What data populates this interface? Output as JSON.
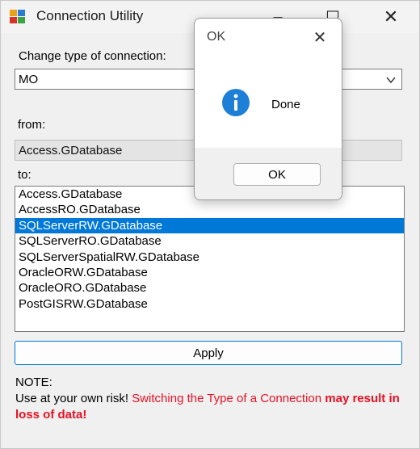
{
  "window": {
    "title": "Connection Utility",
    "minimize_glyph": "–",
    "maximize_glyph": "☐",
    "close_glyph": "✕",
    "icon": "app-grid-icon"
  },
  "form": {
    "change_label": "Change type of connection:",
    "connection_type": "MO",
    "from_label": "from:",
    "from_value": "Access.GDatabase",
    "to_label": "to:",
    "to_options": [
      "Access.GDatabase",
      "AccessRO.GDatabase",
      "SQLServerRW.GDatabase",
      "SQLServerRO.GDatabase",
      "SQLServerSpatialRW.GDatabase",
      "OracleORW.GDatabase",
      "OracleORO.GDatabase",
      "PostGISRW.GDatabase"
    ],
    "selected_index": 2,
    "apply_label": "Apply"
  },
  "note": {
    "heading": "NOTE:",
    "part1": "Use at your own risk! ",
    "part2": "Switching the Type of a Connection  ",
    "part3": "may result in loss of data!"
  },
  "dialog": {
    "title": "OK",
    "close_glyph": "✕",
    "message": "Done",
    "icon": "info-icon",
    "ok_label": "OK"
  },
  "colors": {
    "accent": "#0078d7",
    "warning": "#e81123",
    "info_icon": "#1e7fd6"
  }
}
